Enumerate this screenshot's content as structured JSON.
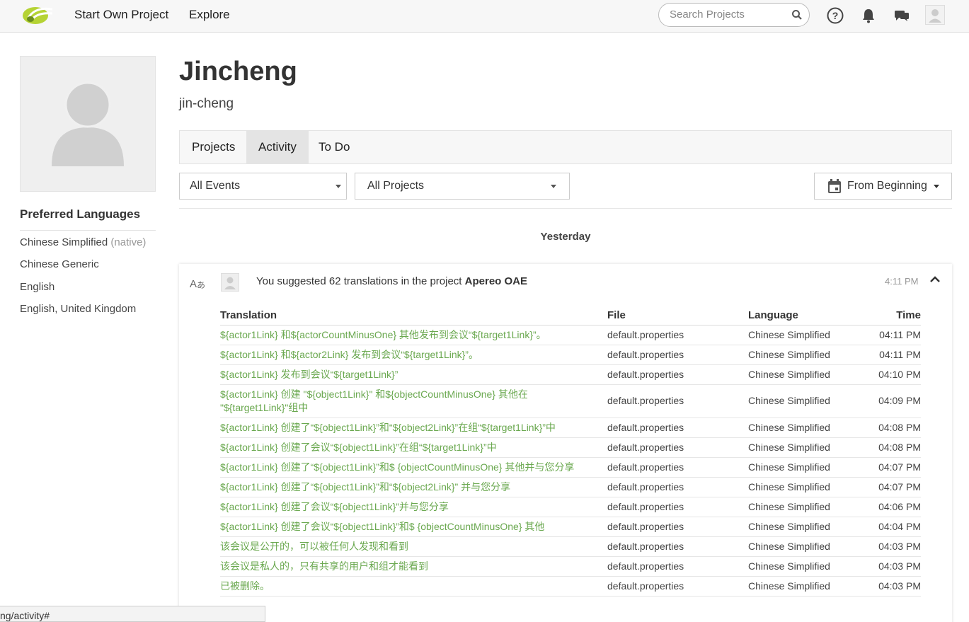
{
  "topbar": {
    "nav": [
      "Start Own Project",
      "Explore"
    ],
    "search_placeholder": "Search Projects",
    "icons": [
      "help-icon",
      "bell-icon",
      "chat-icon",
      "user-avatar"
    ]
  },
  "profile": {
    "name": "Jincheng",
    "username": "jin-cheng",
    "preferred_languages_title": "Preferred Languages",
    "languages": [
      {
        "name": "Chinese Simplified",
        "tag": "(native)"
      },
      {
        "name": "Chinese Generic",
        "tag": ""
      },
      {
        "name": "English",
        "tag": ""
      },
      {
        "name": "English, United Kingdom",
        "tag": ""
      }
    ]
  },
  "tabs": [
    "Projects",
    "Activity",
    "To Do"
  ],
  "filters": {
    "events": "All Events",
    "projects": "All Projects",
    "date": "From Beginning"
  },
  "date_heading": "Yesterday",
  "activity": {
    "message_prefix": "You suggested 62 translations in the project ",
    "project": "Apereo OAE",
    "time": "4:11 PM",
    "columns": [
      "Translation",
      "File",
      "Language",
      "Time"
    ],
    "rows": [
      {
        "translation": "${actor1Link} 和${actorCountMinusOne} 其他发布到会议“${target1Link}”。",
        "file": "default.properties",
        "language": "Chinese Simplified",
        "time": "04:11 PM"
      },
      {
        "translation": "${actor1Link} 和${actor2Link} 发布到会议“${target1Link}”。",
        "file": "default.properties",
        "language": "Chinese Simplified",
        "time": "04:11 PM"
      },
      {
        "translation": "${actor1Link} 发布到会议“${target1Link}”",
        "file": "default.properties",
        "language": "Chinese Simplified",
        "time": "04:10 PM"
      },
      {
        "translation": "${actor1Link} 创建 \"${object1Link}\" 和${objectCountMinusOne} 其他在 \"${target1Link}\"组中",
        "file": "default.properties",
        "language": "Chinese Simplified",
        "time": "04:09 PM"
      },
      {
        "translation": "${actor1Link} 创建了“${object1Link}”和“${object2Link}”在组“${target1Link}”中",
        "file": "default.properties",
        "language": "Chinese Simplified",
        "time": "04:08 PM"
      },
      {
        "translation": "${actor1Link} 创建了会议“${object1Link}”在组“${target1Link}”中",
        "file": "default.properties",
        "language": "Chinese Simplified",
        "time": "04:08 PM"
      },
      {
        "translation": "${actor1Link} 创建了“${object1Link}”和$ {objectCountMinusOne} 其他并与您分享",
        "file": "default.properties",
        "language": "Chinese Simplified",
        "time": "04:07 PM"
      },
      {
        "translation": "${actor1Link} 创建了“${object1Link}”和“${object2Link}” 并与您分享",
        "file": "default.properties",
        "language": "Chinese Simplified",
        "time": "04:07 PM"
      },
      {
        "translation": "${actor1Link} 创建了会议“${object1Link}”并与您分享",
        "file": "default.properties",
        "language": "Chinese Simplified",
        "time": "04:06 PM"
      },
      {
        "translation": "${actor1Link} 创建了会议“${object1Link}”和$ {objectCountMinusOne} 其他",
        "file": "default.properties",
        "language": "Chinese Simplified",
        "time": "04:04 PM"
      },
      {
        "translation": "该会议是公开的，可以被任何人发现和看到",
        "file": "default.properties",
        "language": "Chinese Simplified",
        "time": "04:03 PM"
      },
      {
        "translation": "该会议是私人的，只有共享的用户和组才能看到",
        "file": "default.properties",
        "language": "Chinese Simplified",
        "time": "04:03 PM"
      },
      {
        "translation": "已被删除。",
        "file": "default.properties",
        "language": "Chinese Simplified",
        "time": "04:03 PM"
      }
    ]
  },
  "status_url": "ng/activity#",
  "colors": {
    "translation_text": "#6aa84f",
    "logo": "#9acd32"
  }
}
